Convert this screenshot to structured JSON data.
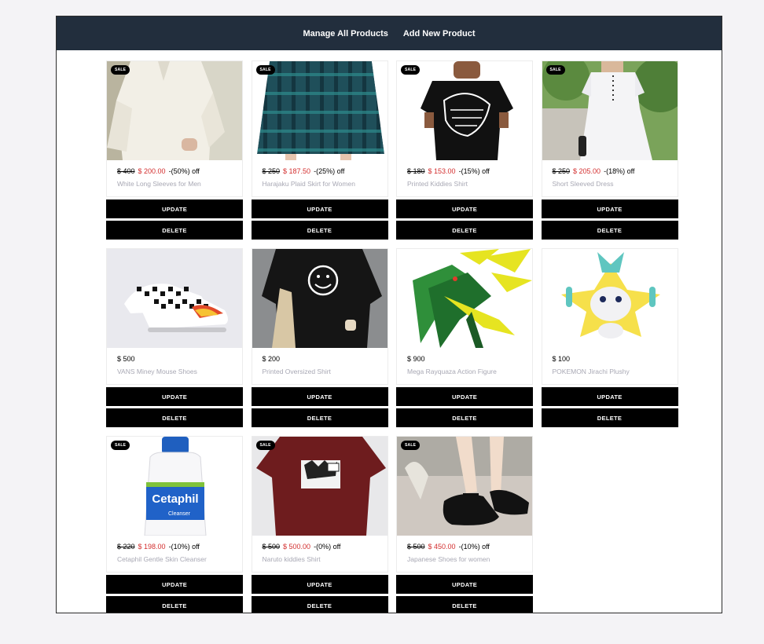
{
  "nav": {
    "manage_label": "Manage All Products",
    "add_label": "Add New Product"
  },
  "buttons": {
    "update": "UPDATE",
    "delete": "DELETE"
  },
  "colors": {
    "navbar": "#222e3d",
    "sale_price": "#d32f2f",
    "button": "#000000"
  },
  "products": [
    {
      "title": "White Long Sleeves for Men",
      "sale": true,
      "sale_badge": "SALE",
      "old_price": "$ 400",
      "price": "$ 200.00",
      "discount": "-(50%) off",
      "image": "white-long-sleeve-shirt"
    },
    {
      "title": "Harajaku Plaid Skirt for Women",
      "sale": true,
      "sale_badge": "SALE",
      "old_price": "$ 250",
      "price": "$ 187.50",
      "discount": "-(25%) off",
      "image": "plaid-skirt"
    },
    {
      "title": "Printed Kiddies Shirt",
      "sale": true,
      "sale_badge": "SALE",
      "old_price": "$ 180",
      "price": "$ 153.00",
      "discount": "-(15%) off",
      "image": "dinosaur-print-shirt"
    },
    {
      "title": "Short Sleeved Dress",
      "sale": true,
      "sale_badge": "SALE",
      "old_price": "$ 250",
      "price": "$ 205.00",
      "discount": "-(18%) off",
      "image": "white-dress"
    },
    {
      "title": "VANS Miney Mouse Shoes",
      "sale": false,
      "sale_badge": "",
      "old_price": "",
      "price": "$ 500",
      "discount": "",
      "image": "checkered-sneakers"
    },
    {
      "title": "Printed Oversized Shirt",
      "sale": false,
      "sale_badge": "",
      "old_price": "",
      "price": "$ 200",
      "discount": "",
      "image": "smiley-black-shirt"
    },
    {
      "title": "Mega Rayquaza Action Figure",
      "sale": false,
      "sale_badge": "",
      "old_price": "",
      "price": "$ 900",
      "discount": "",
      "image": "green-dragon-figure"
    },
    {
      "title": "POKEMON Jirachi Plushy",
      "sale": false,
      "sale_badge": "",
      "old_price": "",
      "price": "$ 100",
      "discount": "",
      "image": "yellow-star-plush"
    },
    {
      "title": "Cetaphil Gentle Skin Cleanser",
      "sale": true,
      "sale_badge": "SALE",
      "old_price": "$ 220",
      "price": "$ 198.00",
      "discount": "-(10%) off",
      "image": "cleanser-bottle",
      "image_text": "Cetaphil",
      "image_subtext": "Cleanser"
    },
    {
      "title": "Naruto kiddies Shirt",
      "sale": true,
      "sale_badge": "SALE",
      "old_price": "$ 500",
      "price": "$ 500.00",
      "discount": "-(0%) off",
      "image": "red-anime-shirt"
    },
    {
      "title": "Japanese Shoes for women",
      "sale": true,
      "sale_badge": "SALE",
      "old_price": "$ 500",
      "price": "$ 450.00",
      "discount": "-(10%) off",
      "image": "black-mary-jane-shoes"
    }
  ]
}
